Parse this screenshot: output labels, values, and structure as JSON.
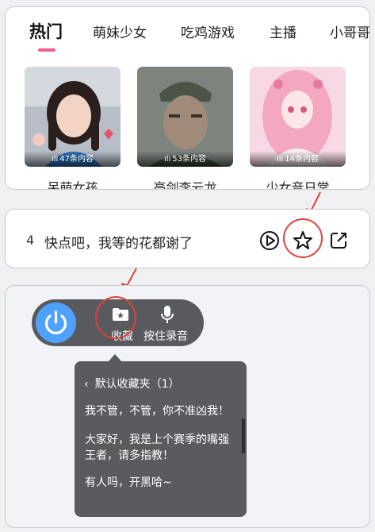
{
  "tabs": [
    "热门",
    "萌妹少女",
    "吃鸡游戏",
    "主播",
    "小哥哥"
  ],
  "active_tab": "热门",
  "cards": [
    {
      "title": "呆萌女孩",
      "count": "47条内容"
    },
    {
      "title": "亮剑李云龙",
      "count": "53条内容"
    },
    {
      "title": "少女音日常",
      "count": "14条内容"
    }
  ],
  "phrase_row": {
    "number": "4",
    "text": "快点吧，我等的花都谢了"
  },
  "voice_bar": {
    "favorite_label": "收藏",
    "record_label": "按住录音"
  },
  "favorites_popup": {
    "header": "默认收藏夹（1）",
    "items": [
      "我不管，不管，你不准凶我！",
      "大家好，我是上个赛季的嘴强王者，请多指教！",
      "有人吗，开黑哈~"
    ]
  },
  "colors": {
    "accent_pink": "#f05a8a",
    "highlight_red": "#e0413d",
    "power_blue": "#4ea1ff",
    "overlay_gray": "#5a5b5f"
  }
}
